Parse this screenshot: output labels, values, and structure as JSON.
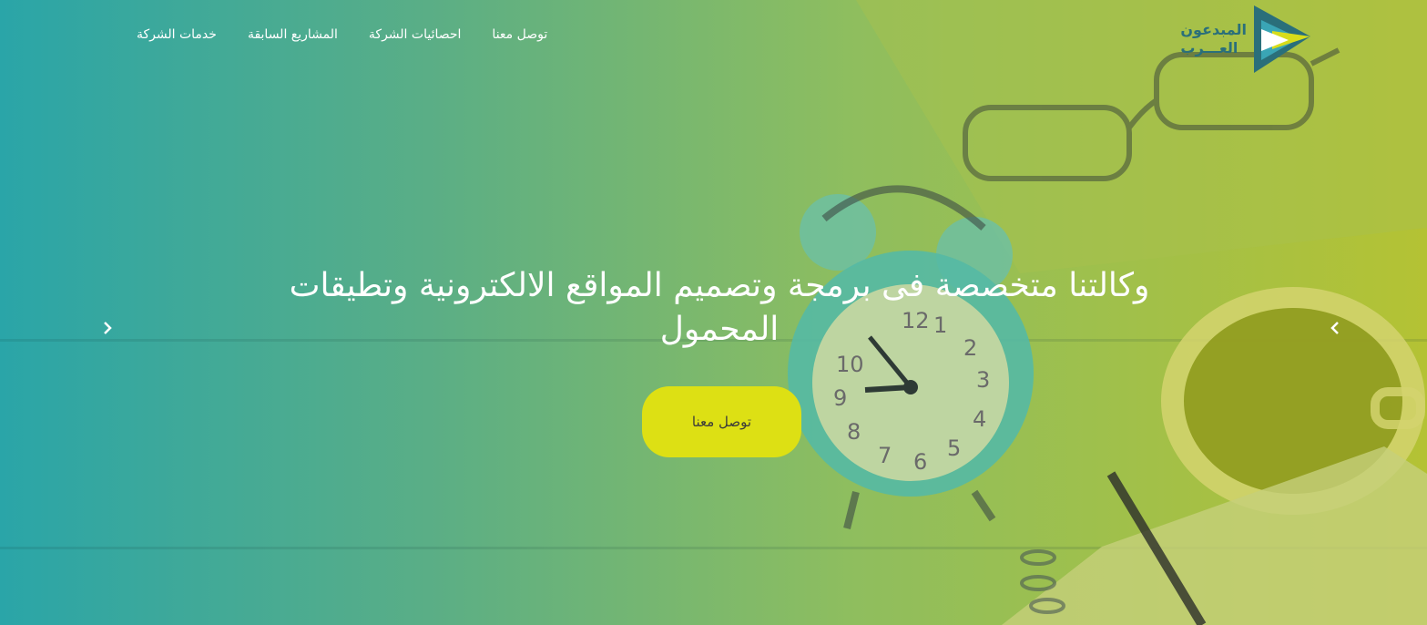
{
  "header": {
    "logo": {
      "line1": "المبدعون",
      "line2": "العـــرب",
      "icon": "play-triangle-logo"
    },
    "nav": [
      {
        "label": "خدمات الشركة"
      },
      {
        "label": "المشاريع السابقة"
      },
      {
        "label": "احصائيات الشركة"
      },
      {
        "label": "توصل معنا"
      }
    ]
  },
  "slider": {
    "headline_line1": "وكالتنا متخصصة فى برمجة وتصميم المواقع الالكترونية وتطيقات",
    "headline_line2": "المحمول",
    "cta_label": "توصل معنا",
    "prev_icon": "chevron-left-icon",
    "next_icon": "chevron-right-icon"
  },
  "colors": {
    "gradient_left": "#2aa5a8",
    "gradient_right": "#b4c234",
    "cta_bg": "#dde014",
    "logo_teal": "#2a6f7a",
    "logo_yellow": "#d7dc1a"
  }
}
